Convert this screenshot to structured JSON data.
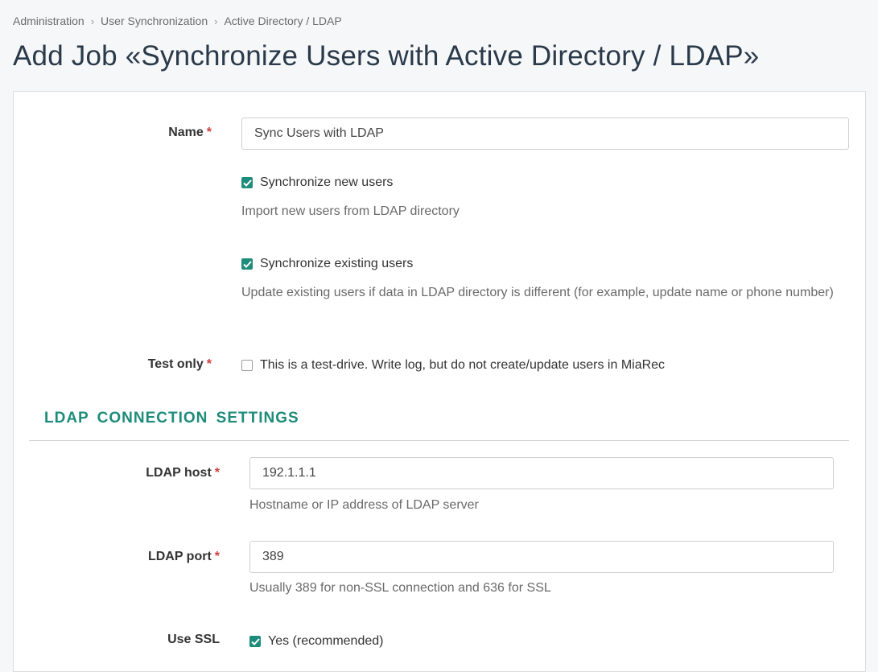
{
  "breadcrumb": {
    "items": [
      "Administration",
      "User Synchronization",
      "Active Directory / LDAP"
    ]
  },
  "page": {
    "title": "Add Job «Synchronize Users with Active Directory / LDAP»"
  },
  "form": {
    "name": {
      "label": "Name",
      "required_mark": "*",
      "value": "Sync Users with LDAP"
    },
    "sync_new_users": {
      "label": "Synchronize new users",
      "checked": true,
      "help": "Import new users from LDAP directory"
    },
    "sync_existing_users": {
      "label": "Synchronize existing users",
      "checked": true,
      "help": "Update existing users if data in LDAP directory is different (for example, update name or phone number)"
    },
    "test_only": {
      "label": "Test only",
      "required_mark": "*",
      "checkbox_label": "This is a test-drive. Write log, but do not create/update users in MiaRec",
      "checked": false
    }
  },
  "ldap_section": {
    "title": "LDAP CONNECTION SETTINGS",
    "host": {
      "label": "LDAP host",
      "required_mark": "*",
      "value": "192.1.1.1",
      "help": "Hostname or IP address of LDAP server"
    },
    "port": {
      "label": "LDAP port",
      "required_mark": "*",
      "value": "389",
      "help": "Usually 389 for non-SSL connection and 636 for SSL"
    },
    "ssl": {
      "label": "Use SSL",
      "checkbox_label": "Yes (recommended)",
      "checked": true
    }
  },
  "colors": {
    "accent": "#1e8c7a",
    "required": "#d23b3b",
    "title": "#2a3a4a"
  }
}
